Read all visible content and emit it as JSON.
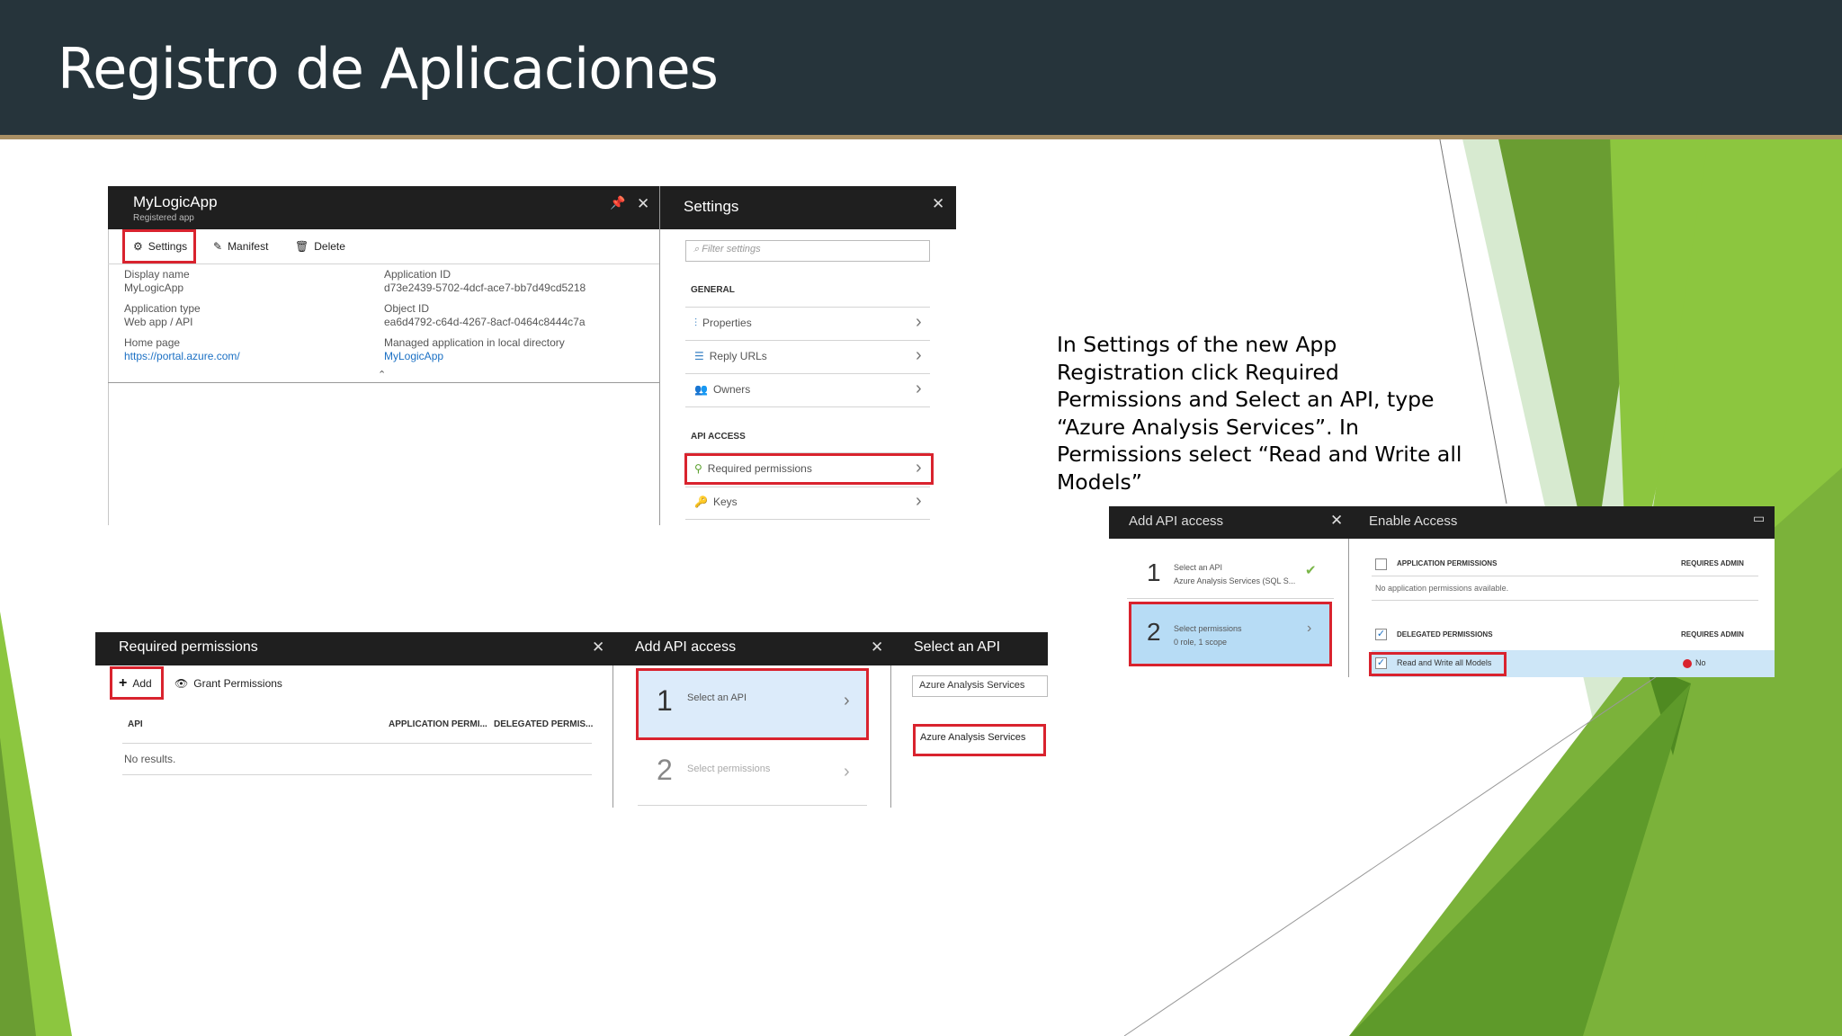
{
  "slide": {
    "title": "Registro de Aplicaciones",
    "description": "In Settings of the new App Registration click Required Permissions and Select an API, type “Azure Analysis Services”. In Permissions select “Read and Write all Models”"
  },
  "colors": {
    "titlebar": "#26343b",
    "accent_line": "#a98f64",
    "green_dark": "#4f8a21",
    "green_light": "#8cc63f",
    "highlight": "#d9232e"
  },
  "shot1": {
    "app_title": "MyLogicApp",
    "app_subtitle": "Registered app",
    "toolbar": {
      "settings": "Settings",
      "manifest": "Manifest",
      "delete": "Delete"
    },
    "fields": {
      "display_name_label": "Display name",
      "display_name": "MyLogicApp",
      "app_type_label": "Application type",
      "app_type": "Web app / API",
      "home_page_label": "Home page",
      "home_page": "https://portal.azure.com/",
      "app_id_label": "Application ID",
      "app_id": "d73e2439-5702-4dcf-ace7-bb7d49cd5218",
      "object_id_label": "Object ID",
      "object_id": "ea6d4792-c64d-4267-8acf-0464c8444c7a",
      "managed_label": "Managed application in local directory",
      "managed": "MyLogicApp"
    },
    "settings": {
      "title": "Settings",
      "filter_placeholder": "Filter settings",
      "general": "GENERAL",
      "properties": "Properties",
      "reply_urls": "Reply URLs",
      "owners": "Owners",
      "api_access": "API ACCESS",
      "required_permissions": "Required permissions",
      "keys": "Keys"
    }
  },
  "shot2": {
    "req_title": "Required permissions",
    "add": "Add",
    "grant": "Grant Permissions",
    "col_api": "API",
    "col_app": "APPLICATION PERMI...",
    "col_del": "DELEGATED PERMIS...",
    "no_results": "No results.",
    "add_title": "Add API access",
    "step1_num": "1",
    "step1": "Select an API",
    "step2_num": "2",
    "step2": "Select permissions",
    "select_title": "Select an API",
    "search": "Azure Analysis Services",
    "result": "Azure Analysis Services"
  },
  "shot3": {
    "add_title": "Add API access",
    "step1_num": "1",
    "step1": "Select an API",
    "step1_sub": "Azure Analysis Services (SQL S...",
    "step2_num": "2",
    "step2": "Select permissions",
    "step2_sub": "0 role, 1 scope",
    "enable_title": "Enable Access",
    "app_perms": "APPLICATION PERMISSIONS",
    "requires_admin": "REQUIRES ADMIN",
    "no_app_perms": "No application permissions available.",
    "del_perms": "DELEGATED PERMISSIONS",
    "requires_admin2": "REQUIRES ADMIN",
    "read_write": "Read and Write all Models",
    "no": "No"
  }
}
